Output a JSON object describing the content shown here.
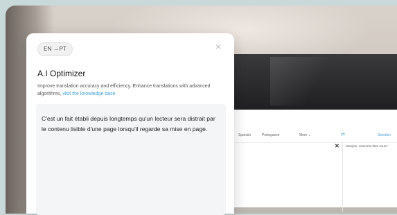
{
  "dialog": {
    "language_chip": "EN →PT",
    "close_symbol": "×",
    "title": "A.I Optimizer",
    "description_text": "Improve translation accuracy and efficiency. Enhance translations with advanced algorithms, ",
    "knowledge_link": "visit the knowledge base",
    "input_text": "C'est un fait établi depuis longtemps qu'un lecteur sera distrait par le contenu lisible d'une page lorsqu'il regarde sa mise en page."
  },
  "background_app": {
    "languages": [
      "Spanish",
      "Portuguese",
      "More ⌄"
    ],
    "target_language": "Swedish",
    "swap_symbol": "⇄",
    "clear_symbol": "✕",
    "output_text": "Bonjour, comment êtes-vous?"
  },
  "colors": {
    "accent": "#3ea0d6",
    "panel_bg": "#ffffff",
    "textbox_bg": "#f4f5f7"
  }
}
